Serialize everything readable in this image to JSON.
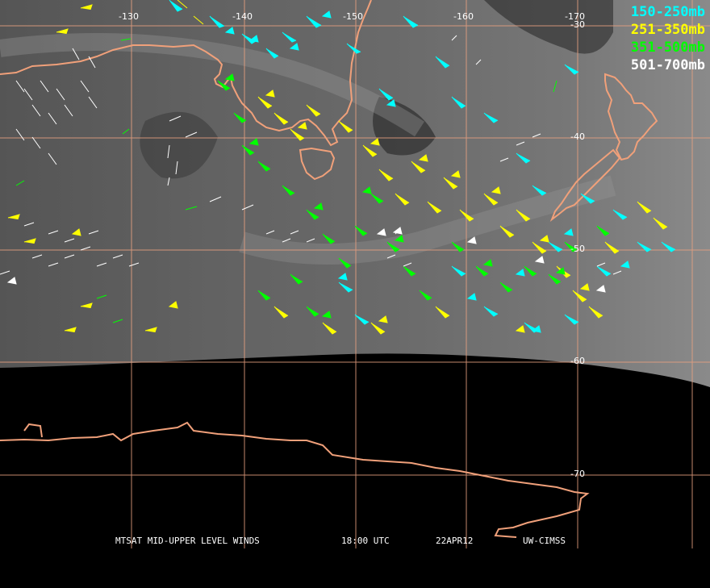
{
  "legend": [
    {
      "label": "150-250mb",
      "color": "#00ffff"
    },
    {
      "label": "251-350mb",
      "color": "#ffff00"
    },
    {
      "label": "351-500mb",
      "color": "#00ff00"
    },
    {
      "label": "501-700mb",
      "color": "#ffffff"
    }
  ],
  "longitude_labels": [
    "-130",
    "-140",
    "-150",
    "-160",
    "-170"
  ],
  "latitude_labels": [
    "-30",
    "-40",
    "-50",
    "-60",
    "-70"
  ],
  "footer": {
    "product": "MTSAT MID-UPPER LEVEL WINDS",
    "time": "18:00 UTC",
    "date": "22APR12",
    "source": "UW-CIMSS"
  },
  "colors": {
    "coastline": "#f0a07a",
    "gridline": "#e8a080",
    "background": "#000000",
    "imagery": "#6a6a6a"
  }
}
